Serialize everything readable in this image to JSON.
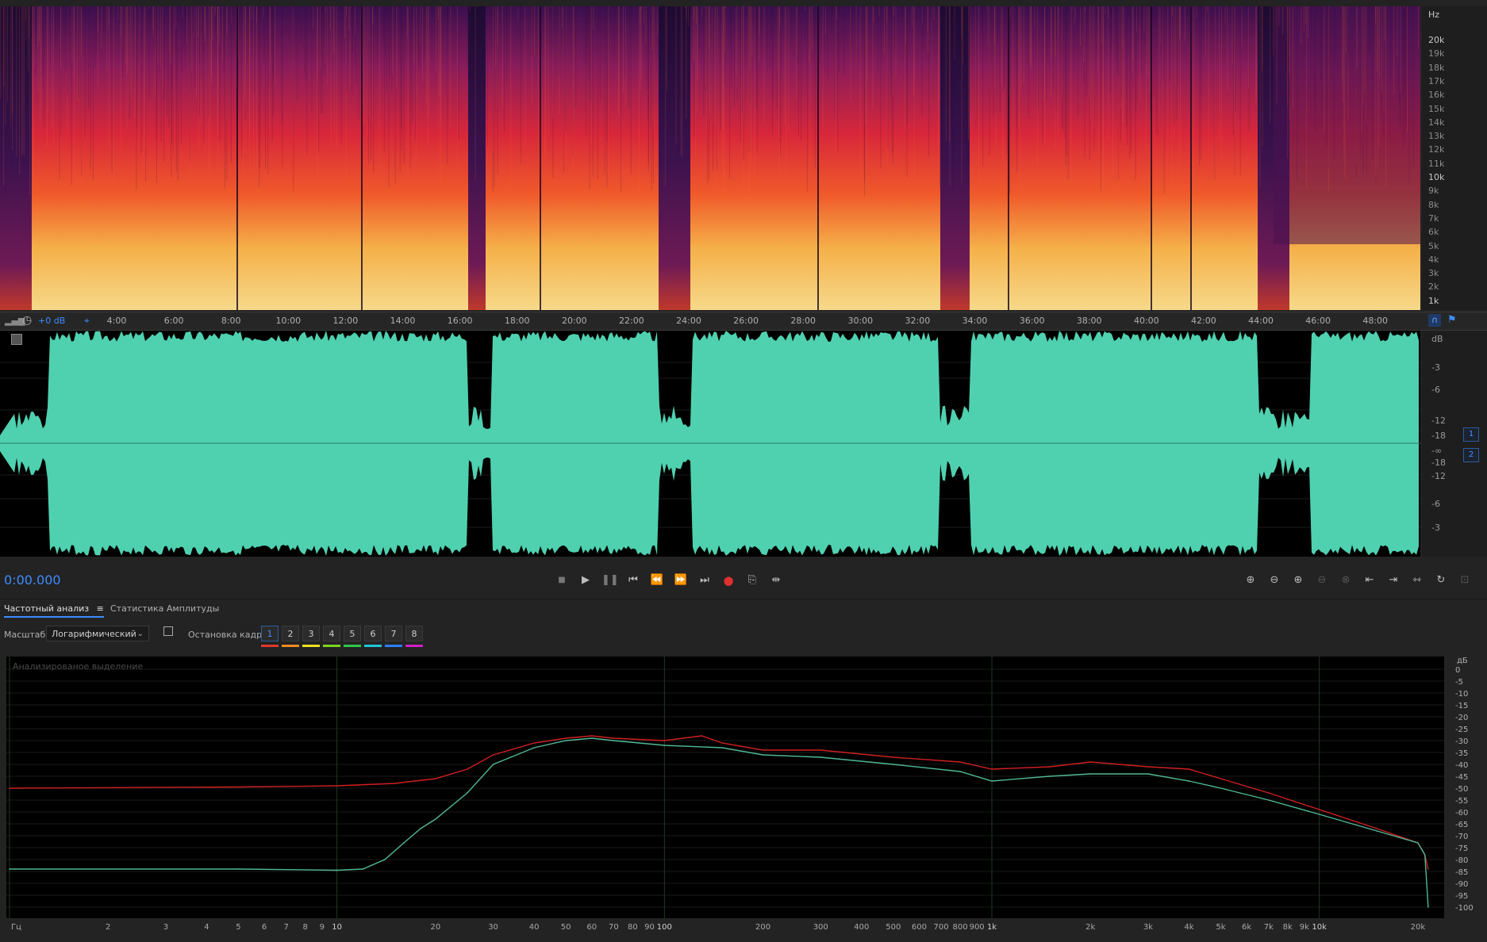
{
  "spectrogram": {
    "unit_label": "Hz",
    "freq_ticks": [
      "20k",
      "19k",
      "18k",
      "17k",
      "16k",
      "15k",
      "14k",
      "13k",
      "12k",
      "11k",
      "10k",
      "9k",
      "8k",
      "7k",
      "6k",
      "5k",
      "4k",
      "3k",
      "2k",
      "1k"
    ]
  },
  "timeline": {
    "gain": "+0 dB",
    "labels": [
      "4:00",
      "6:00",
      "8:00",
      "10:00",
      "12:00",
      "14:00",
      "16:00",
      "18:00",
      "20:00",
      "22:00",
      "24:00",
      "26:00",
      "28:00",
      "30:00",
      "32:00",
      "34:00",
      "36:00",
      "38:00",
      "40:00",
      "42:00",
      "44:00",
      "46:00",
      "48:00"
    ]
  },
  "waveform": {
    "db_label": "dB",
    "db_ticks_top": [
      "-3",
      "-6",
      "-12",
      "-18",
      "-∞"
    ],
    "db_ticks_bottom": [
      "-18",
      "-12",
      "-6",
      "-3"
    ],
    "channels": [
      "1",
      "2"
    ],
    "color": "#4fd1b0"
  },
  "transport": {
    "time": "0:00.000"
  },
  "panel": {
    "tabs": [
      {
        "label": "Частотный анализ",
        "menu_icon": "≡"
      },
      {
        "label": "Статистика Амплитуды"
      }
    ],
    "scale_label": "Масштаб:",
    "scale_value": "Логарифмический",
    "freeze_label": "Остановка кадра:",
    "frames": [
      "1",
      "2",
      "3",
      "4",
      "5",
      "6",
      "7",
      "8"
    ],
    "frame_colors": [
      "#e0382c",
      "#f08c1e",
      "#f0e020",
      "#7ed321",
      "#2ec84a",
      "#1ec8d8",
      "#2a7fff",
      "#d020c8"
    ]
  },
  "analysis": {
    "overlay_label": "Анализированое выделение",
    "db_unit": "дБ",
    "db_ticks": [
      "0",
      "-5",
      "-10",
      "-15",
      "-20",
      "-25",
      "-30",
      "-35",
      "-40",
      "-45",
      "-50",
      "-55",
      "-60",
      "-65",
      "-70",
      "-75",
      "-80",
      "-85",
      "-90",
      "-95",
      "-100"
    ],
    "freq_unit": "Гц",
    "freq_labels": [
      "2",
      "3",
      "4",
      "5",
      "6",
      "7",
      "8",
      "9",
      "10",
      "20",
      "30",
      "40",
      "50",
      "60",
      "70",
      "80",
      "90",
      "100",
      "200",
      "300",
      "400",
      "500",
      "600",
      "700",
      "800",
      "900",
      "1k",
      "2k",
      "3k",
      "4k",
      "5k",
      "6k",
      "7k",
      "8k",
      "9k",
      "10k",
      "20k"
    ]
  },
  "chart_data": {
    "type": "line",
    "xlabel": "Гц",
    "ylabel": "дБ",
    "xscale": "log",
    "xlim": [
      1,
      22000
    ],
    "ylim": [
      -100,
      0
    ],
    "series": [
      {
        "color": "#d02020",
        "x": [
          1,
          5,
          10,
          15,
          20,
          25,
          30,
          40,
          50,
          60,
          70,
          100,
          130,
          150,
          200,
          300,
          500,
          800,
          1000,
          1500,
          2000,
          3000,
          4000,
          5000,
          7000,
          10000,
          15000,
          20000,
          21000,
          21500
        ],
        "y": [
          -50,
          -49.5,
          -49,
          -48,
          -46,
          -42,
          -36,
          -31,
          -29,
          -28,
          -29,
          -30,
          -28,
          -31,
          -34,
          -34,
          -37,
          -39,
          -42,
          -41,
          -39,
          -41,
          -42,
          -46,
          -52,
          -59,
          -67,
          -73,
          -78,
          -84
        ]
      },
      {
        "color": "#4fb896",
        "x": [
          1,
          5,
          10,
          12,
          14,
          16,
          18,
          20,
          25,
          30,
          40,
          50,
          60,
          70,
          100,
          150,
          200,
          300,
          500,
          800,
          1000,
          1500,
          2000,
          3000,
          4000,
          5000,
          7000,
          10000,
          15000,
          20000,
          21000,
          21500
        ],
        "y": [
          -84,
          -84,
          -84.5,
          -84,
          -80,
          -73,
          -67,
          -63,
          -52,
          -40,
          -33,
          -30,
          -29,
          -30,
          -32,
          -33,
          -36,
          -37,
          -40,
          -43,
          -47,
          -45,
          -44,
          -44,
          -47,
          -50,
          -55,
          -61,
          -68,
          -73,
          -78,
          -100
        ]
      }
    ]
  }
}
